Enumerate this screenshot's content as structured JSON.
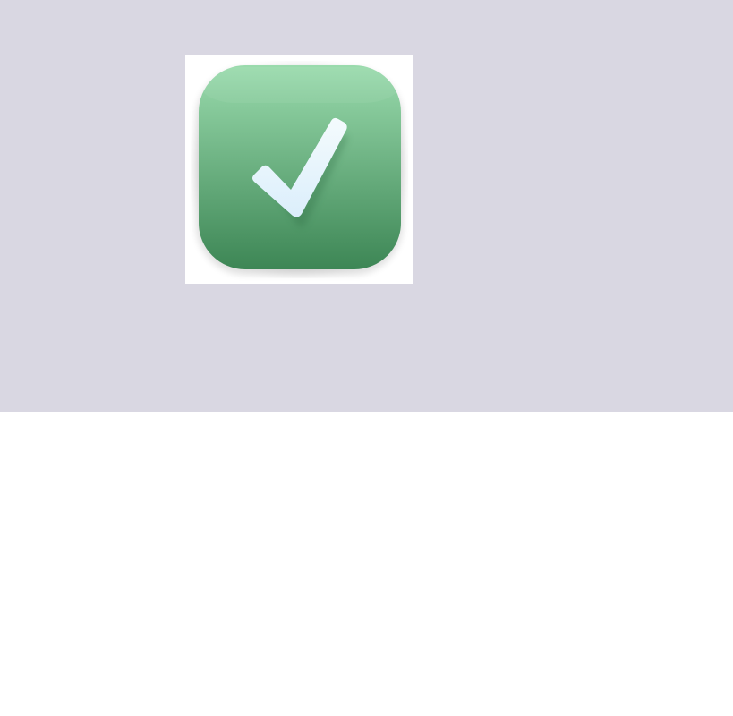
{
  "app_icon": {
    "name": "checkmark-icon",
    "colors": {
      "background_panel": "#d9d7e2",
      "tile_top": "#9adbad",
      "tile_bottom": "#3d8655",
      "check_top": "#f4fbfd",
      "check_bottom": "#dbeefb"
    }
  }
}
